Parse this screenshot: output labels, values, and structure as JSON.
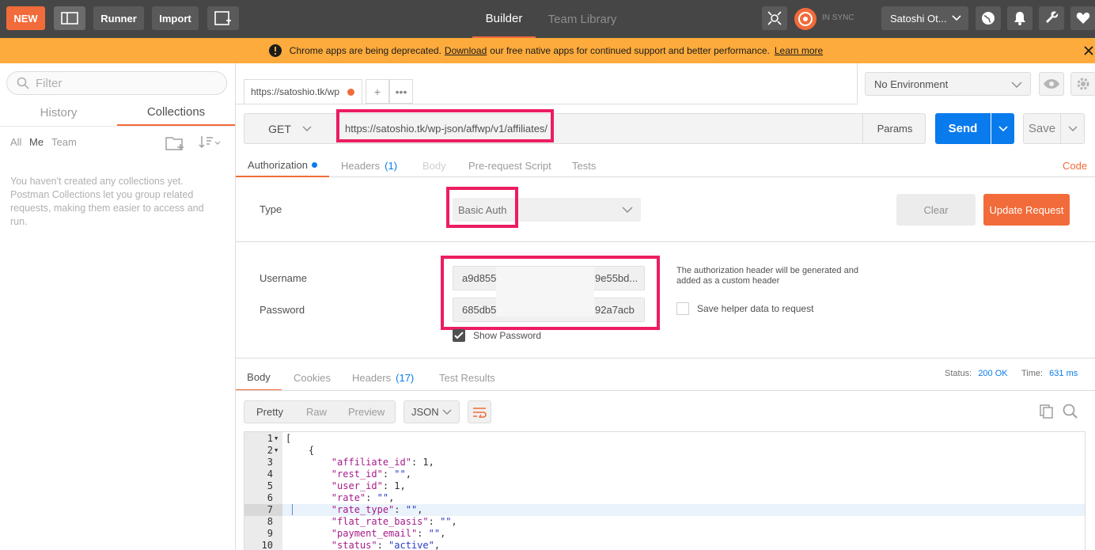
{
  "topbar": {
    "new_label": "NEW",
    "runner_label": "Runner",
    "import_label": "Import",
    "tabs": [
      {
        "label": "Builder"
      },
      {
        "label": "Team Library"
      }
    ],
    "sync_label": "IN SYNC",
    "user_label": "Satoshi Ot..."
  },
  "banner": {
    "text_before": "Chrome apps are being deprecated.",
    "download_link": "Download",
    "text_after": "our free native apps for continued support and better performance.",
    "learn_more": "Learn more"
  },
  "sidebar": {
    "filter_placeholder": "Filter",
    "tabs": [
      {
        "label": "History"
      },
      {
        "label": "Collections"
      }
    ],
    "filters": [
      {
        "label": "All"
      },
      {
        "label": "Me"
      },
      {
        "label": "Team"
      }
    ],
    "empty_message": "You haven't created any collections yet. Postman Collections let you group related requests, making them easier to access and run."
  },
  "request_tab": {
    "label": "https://satoshio.tk/wp"
  },
  "environment": {
    "selected": "No Environment"
  },
  "url_row": {
    "method": "GET",
    "url": "https://satoshio.tk/wp-json/affwp/v1/affiliates/",
    "params_label": "Params",
    "send_label": "Send",
    "save_label": "Save"
  },
  "request_tabs": {
    "authorization": "Authorization",
    "headers": "Headers",
    "headers_count": "(1)",
    "body": "Body",
    "prerequest": "Pre-request Script",
    "tests": "Tests",
    "code": "Code"
  },
  "auth": {
    "type_label": "Type",
    "type_value": "Basic Auth",
    "clear_label": "Clear",
    "update_label": "Update Request",
    "username_label": "Username",
    "username_start": "a9d855",
    "username_end": "9e55bd...",
    "password_label": "Password",
    "password_start": "685db5",
    "password_end": "92a7acb",
    "help_text": "The authorization header will be generated and added as a custom header",
    "helper_label": "Save helper data to request",
    "show_password_label": "Show Password"
  },
  "response": {
    "tabs": {
      "body": "Body",
      "cookies": "Cookies",
      "headers": "Headers",
      "headers_count": "(17)",
      "test_results": "Test Results"
    },
    "status_label": "Status:",
    "status_value": "200 OK",
    "time_label": "Time:",
    "time_value": "631 ms",
    "views": {
      "pretty": "Pretty",
      "raw": "Raw",
      "preview": "Preview"
    },
    "format": "JSON",
    "lines": [
      {
        "n": "1",
        "text": "["
      },
      {
        "n": "2",
        "text": "    {"
      },
      {
        "n": "3",
        "key": "\"affiliate_id\"",
        "val": "1",
        "type": "num"
      },
      {
        "n": "4",
        "key": "\"rest_id\"",
        "val": "\"\"",
        "type": "str"
      },
      {
        "n": "5",
        "key": "\"user_id\"",
        "val": "1",
        "type": "num"
      },
      {
        "n": "6",
        "key": "\"rate\"",
        "val": "\"\"",
        "type": "str"
      },
      {
        "n": "7",
        "key": "\"rate_type\"",
        "val": "\"\"",
        "type": "str"
      },
      {
        "n": "8",
        "key": "\"flat_rate_basis\"",
        "val": "\"\"",
        "type": "str"
      },
      {
        "n": "9",
        "key": "\"payment_email\"",
        "val": "\"\"",
        "type": "str"
      },
      {
        "n": "10",
        "key": "\"status\"",
        "val": "\"active\"",
        "type": "str"
      }
    ]
  },
  "colors": {
    "accent": "#f26b3a",
    "send_blue": "#097bed",
    "banner": "#fcab3c",
    "highlight": "#ec1d60"
  }
}
